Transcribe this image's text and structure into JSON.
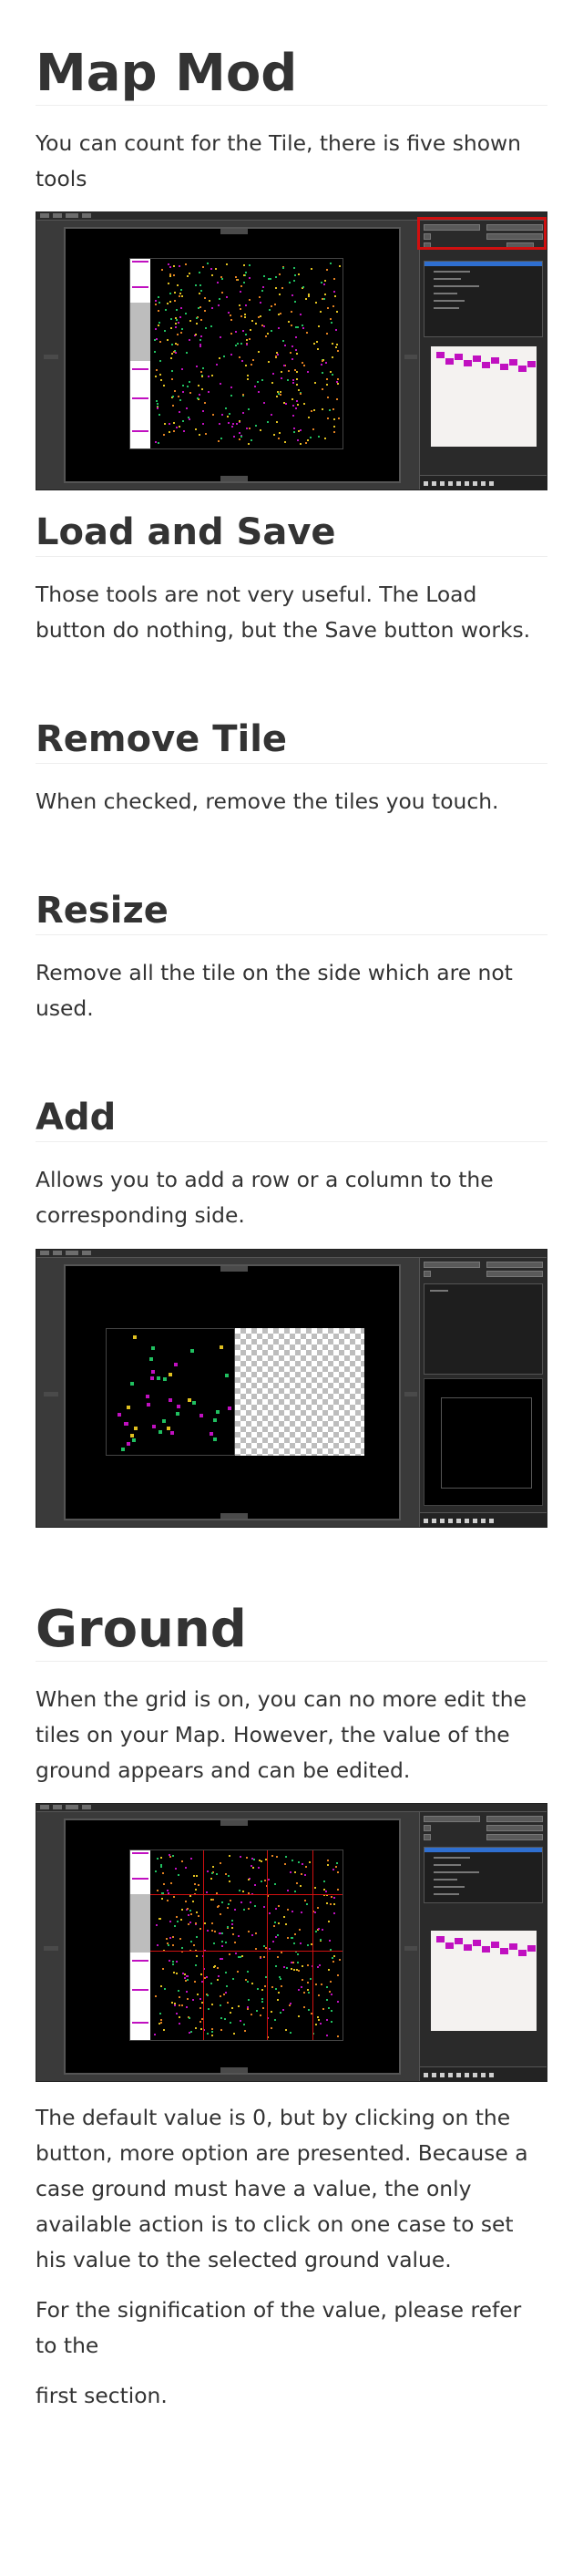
{
  "title": "Map Mod",
  "intro": "You can count for the Tile, there is five shown tools",
  "sections": {
    "load_save": {
      "heading": "Load and Save",
      "text": "Those tools are not very useful. The Load button do nothing, but the Save button works."
    },
    "remove_tile": {
      "heading": "Remove Tile",
      "text": "When checked, remove the tiles you touch."
    },
    "resize": {
      "heading": "Resize",
      "text": "Remove all the tile on the side which are not used."
    },
    "add": {
      "heading": "Add",
      "text": "Allows you to add a row or a column to the corresponding side."
    },
    "ground": {
      "heading": "Ground",
      "text": "When the grid is on, you can no more edit the tiles on your Map. However, the value of the ground appears and can be edited.",
      "text2": "The default value is 0, but by clicking on the button, more option are presented. Because a case ground must have a value, the only available action is to click on one case to set his value to the selected ground value.",
      "text3": "For the signification of the value, please refer to the",
      "link": "first section."
    }
  },
  "colors": {
    "heading": "#333333",
    "text": "#333333",
    "rule": "#eeeeee",
    "highlight": "#d01010",
    "tile_magenta": "#c010c0",
    "tile_yellow": "#e0c020",
    "tile_green": "#20c060"
  }
}
